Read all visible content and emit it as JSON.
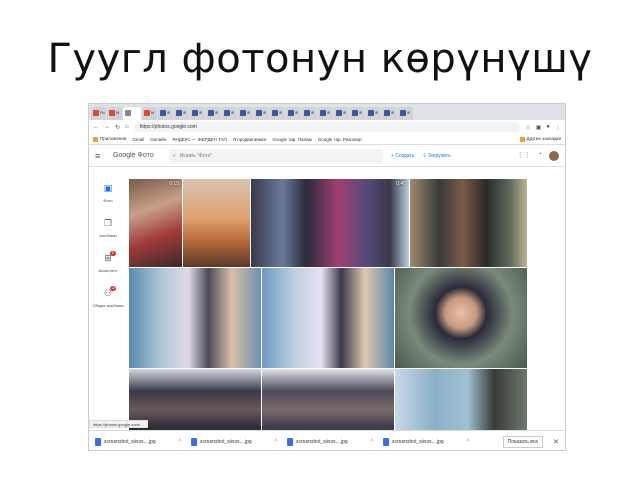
{
  "slide": {
    "title": "Гуугл фотонун көрүнүшү"
  },
  "browser": {
    "tabs": [
      "Ро",
      "М",
      "",
      "М",
      "Ф",
      "Ф",
      "Ф",
      "Ф",
      "Ф",
      "Ф",
      "Ф",
      "Ф",
      "Ф",
      "Ф",
      "Ф",
      "Ф",
      "Ф",
      "Ф",
      "Ф",
      "Ф"
    ],
    "url": "https://photos.google.com",
    "bookmarks": [
      "Приложения",
      "Gmail",
      "Онлайн",
      "ЯНДЕКС — ЖЕРДЕН ТАП",
      "Я продвигаемся",
      "Google тар. Палам",
      "Google тар. Разговор",
      "Другие закладки"
    ]
  },
  "app": {
    "logo_text": "Google Фото",
    "search_placeholder": "Искать \"Фото\"",
    "create_label": "Создать",
    "upload_label": "Загрузить",
    "nav": [
      {
        "label": "Фото",
        "icon": "photo-icon",
        "badge": ""
      },
      {
        "label": "Альбомы",
        "icon": "album-icon",
        "badge": ""
      },
      {
        "label": "Ассистент",
        "icon": "assistant-icon",
        "badge": "6"
      },
      {
        "label": "Общие альбомы",
        "icon": "shared-icon",
        "badge": "12"
      }
    ],
    "durations": [
      "0:15",
      "0:40"
    ]
  },
  "statusbar": {
    "link": "https://photos.google.com/…"
  },
  "downloads": {
    "items": [
      "screenshot_wixss....jpg",
      "screenshot_wixss....jpg",
      "screenshot_wixss....jpg",
      "screenshot_wixss....jpg"
    ],
    "show_all": "Показать все"
  },
  "colors": {
    "accent": "#1a73e8",
    "badge": "#d93025"
  }
}
